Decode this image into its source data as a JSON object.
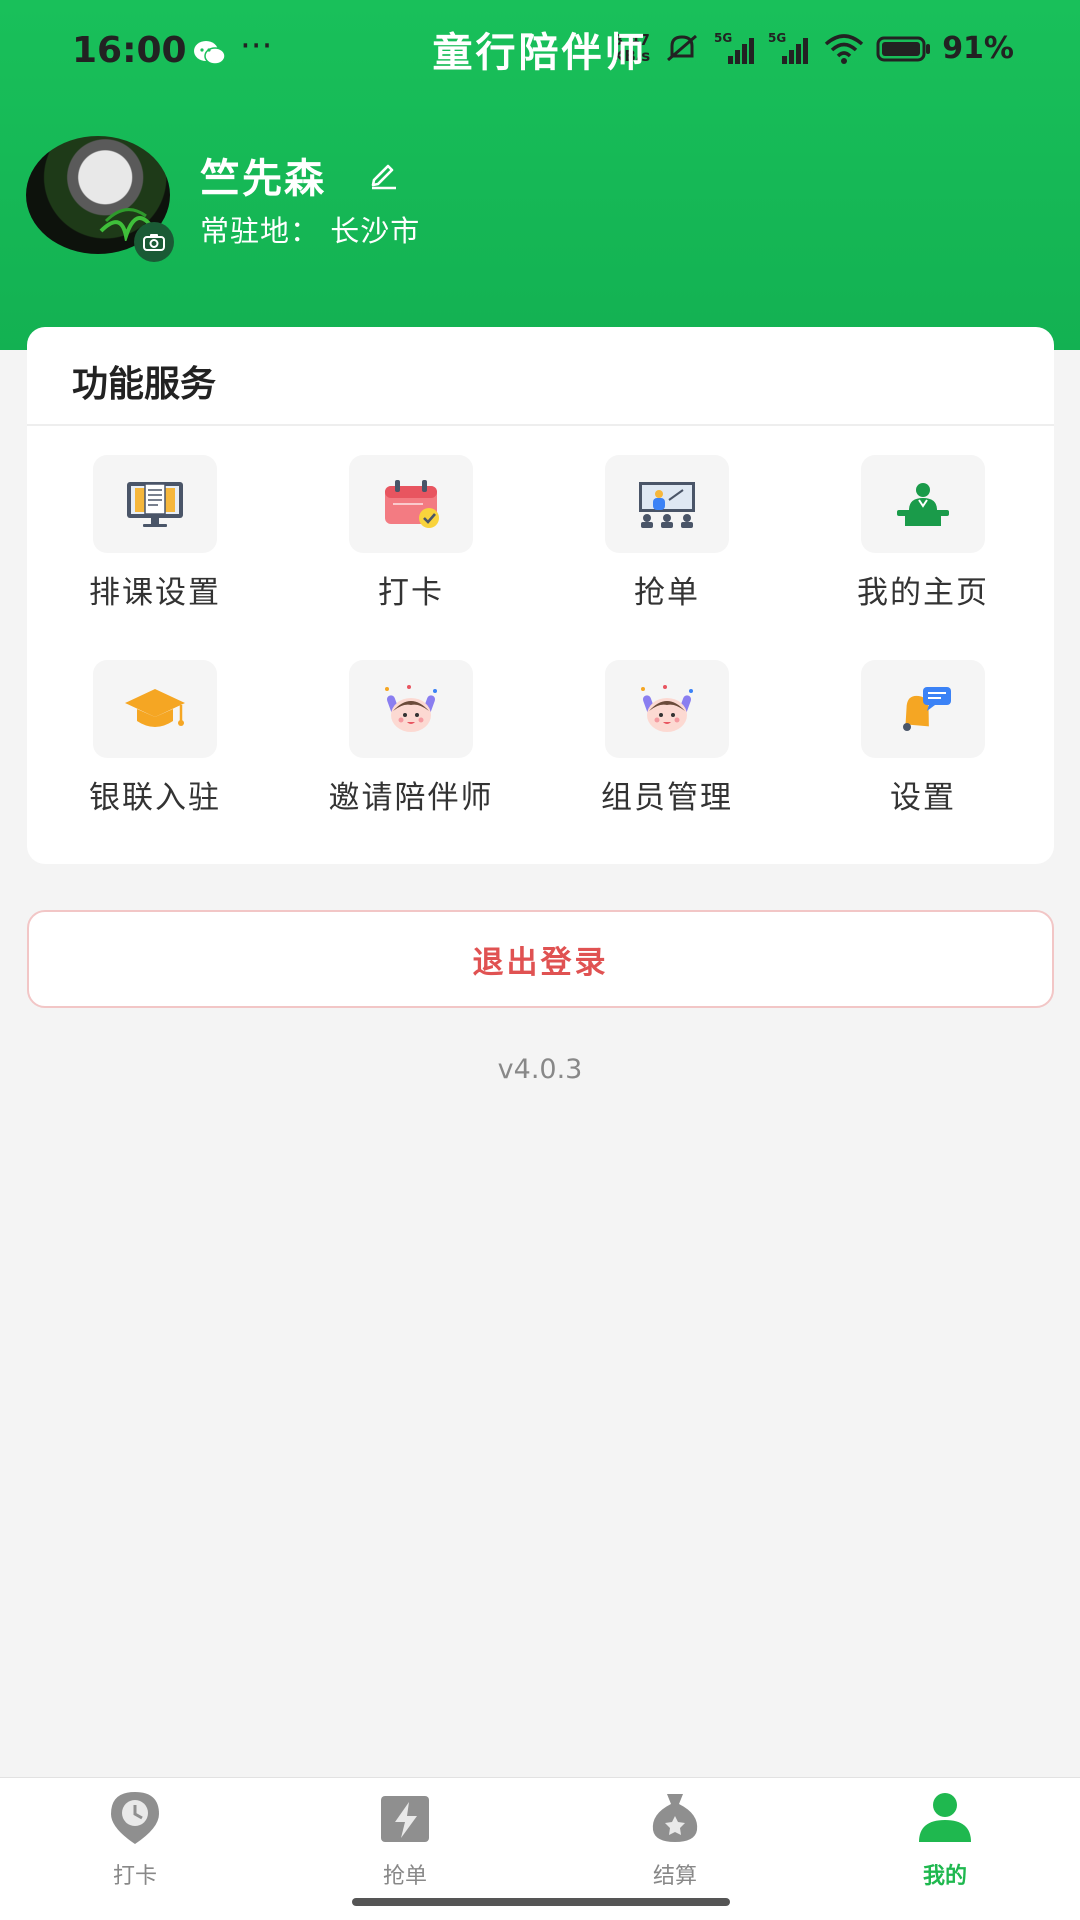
{
  "status_bar": {
    "time": "16:00",
    "dots": "···",
    "speed_value": "3.47",
    "speed_unit": "KB/s",
    "network1": "5G",
    "network2": "5G",
    "battery": "91%"
  },
  "app": {
    "title": "童行陪伴师"
  },
  "profile": {
    "name": "竺先森",
    "location": "常驻地：  长沙市"
  },
  "services": {
    "title": "功能服务",
    "items": [
      {
        "label": "排课设置",
        "icon": "schedule-monitor-icon"
      },
      {
        "label": "打卡",
        "icon": "calendar-check-icon"
      },
      {
        "label": "抢单",
        "icon": "classroom-icon"
      },
      {
        "label": "我的主页",
        "icon": "speaker-podium-icon"
      },
      {
        "label": "银联入驻",
        "icon": "graduation-cap-icon"
      },
      {
        "label": "邀请陪伴师",
        "icon": "cheering-kid-icon"
      },
      {
        "label": "组员管理",
        "icon": "cheering-kid-icon"
      },
      {
        "label": "设置",
        "icon": "bell-chat-icon"
      }
    ]
  },
  "logout_label": "退出登录",
  "version": "v4.0.3",
  "tabbar": {
    "items": [
      {
        "label": "打卡",
        "icon": "clock-pin-icon",
        "active": false
      },
      {
        "label": "抢单",
        "icon": "lightning-icon",
        "active": false
      },
      {
        "label": "结算",
        "icon": "money-bag-icon",
        "active": false
      },
      {
        "label": "我的",
        "icon": "person-icon",
        "active": true
      }
    ],
    "active_color": "#1fb84f",
    "inactive_color": "#888888"
  },
  "colors": {
    "brand_green": "#13b152",
    "logout_red": "#e05252"
  }
}
